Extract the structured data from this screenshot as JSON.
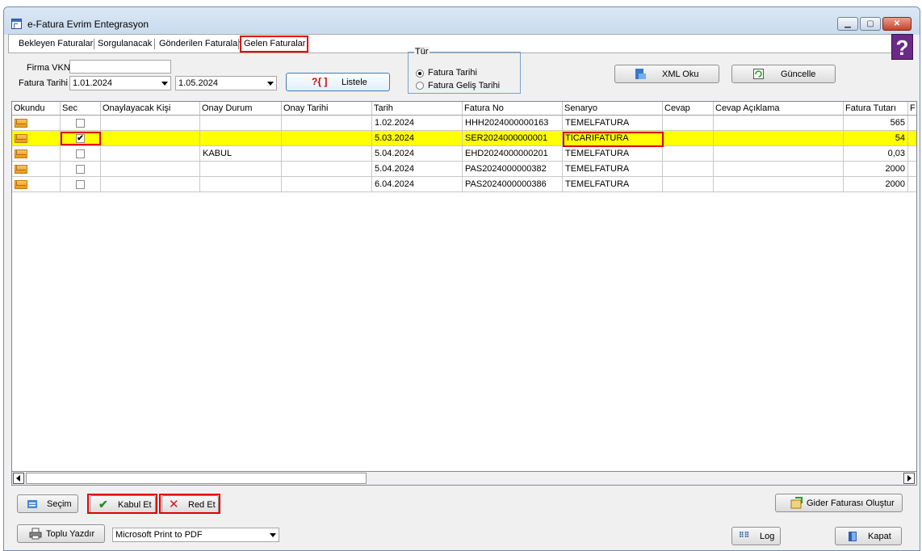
{
  "window": {
    "title": "e-Fatura Evrim Entegrasyon"
  },
  "tabs": [
    "Bekleyen Faturalar",
    "Sorgulanacak",
    "Gönderilen Faturalar",
    "Gelen Faturalar"
  ],
  "filters": {
    "firma_vkn_label": "Firma VKN",
    "firma_vkn_value": "",
    "fatura_tarihi_label": "Fatura Tarihi",
    "date_from": "1.01.2024",
    "date_to": "1.05.2024",
    "listele_label": "Listele",
    "tur_legend": "Tür",
    "radio_options": [
      "Fatura Tarihi",
      "Fatura Geliş Tarihi"
    ],
    "selected_radio": "Fatura Tarihi"
  },
  "toolbar": {
    "xml_oku": "XML Oku",
    "guncelle": "Güncelle"
  },
  "grid": {
    "columns": [
      "Okundu",
      "Sec",
      "Onaylayacak Kişi",
      "Onay Durum",
      "Onay Tarihi",
      "Tarih",
      "Fatura No",
      "Senaryo",
      "Cevap",
      "Cevap Açıklama",
      "Fatura Tutarı",
      "F"
    ],
    "rows": [
      {
        "checked": false,
        "onaylayacak": "",
        "onay_durum": "",
        "onay_tarihi": "",
        "tarih": "1.02.2024",
        "fatura_no": "HHH2024000000163",
        "senaryo": "TEMELFATURA",
        "cevap": "",
        "cevap_aciklama": "",
        "tutar": "565",
        "highlight": false
      },
      {
        "checked": true,
        "onaylayacak": "",
        "onay_durum": "",
        "onay_tarihi": "",
        "tarih": "5.03.2024",
        "fatura_no": "SER2024000000001",
        "senaryo": "TICARIFATURA",
        "cevap": "",
        "cevap_aciklama": "",
        "tutar": "54",
        "highlight": true
      },
      {
        "checked": false,
        "onaylayacak": "",
        "onay_durum": "KABUL",
        "onay_tarihi": "",
        "tarih": "5.04.2024",
        "fatura_no": "EHD2024000000201",
        "senaryo": "TEMELFATURA",
        "cevap": "",
        "cevap_aciklama": "",
        "tutar": "0,03",
        "highlight": false
      },
      {
        "checked": false,
        "onaylayacak": "",
        "onay_durum": "",
        "onay_tarihi": "",
        "tarih": "5.04.2024",
        "fatura_no": "PAS2024000000382",
        "senaryo": "TEMELFATURA",
        "cevap": "",
        "cevap_aciklama": "",
        "tutar": "2000",
        "highlight": false
      },
      {
        "checked": false,
        "onaylayacak": "",
        "onay_durum": "",
        "onay_tarihi": "",
        "tarih": "6.04.2024",
        "fatura_no": "PAS2024000000386",
        "senaryo": "TEMELFATURA",
        "cevap": "",
        "cevap_aciklama": "",
        "tutar": "2000",
        "highlight": false
      }
    ]
  },
  "actions": {
    "secim": "Seçim",
    "kabul_et": "Kabul Et",
    "red_et": "Red Et",
    "gider": "Gider Faturası Oluştur"
  },
  "bottom": {
    "toplu_yazdir": "Toplu Yazdır",
    "printer": "Microsoft Print to PDF",
    "log": "Log",
    "kapat": "Kapat"
  },
  "colors": {
    "highlight_row": "#ffff00",
    "annotation_red": "#e00000",
    "help_purple": "#6b2a86"
  },
  "icons": [
    "window-icon",
    "help-icon",
    "xml-icon",
    "refresh-icon",
    "envelope-icon",
    "printer-icon",
    "checkmark-icon",
    "x-icon",
    "gider-icon",
    "log-icon",
    "exit-door-icon"
  ]
}
